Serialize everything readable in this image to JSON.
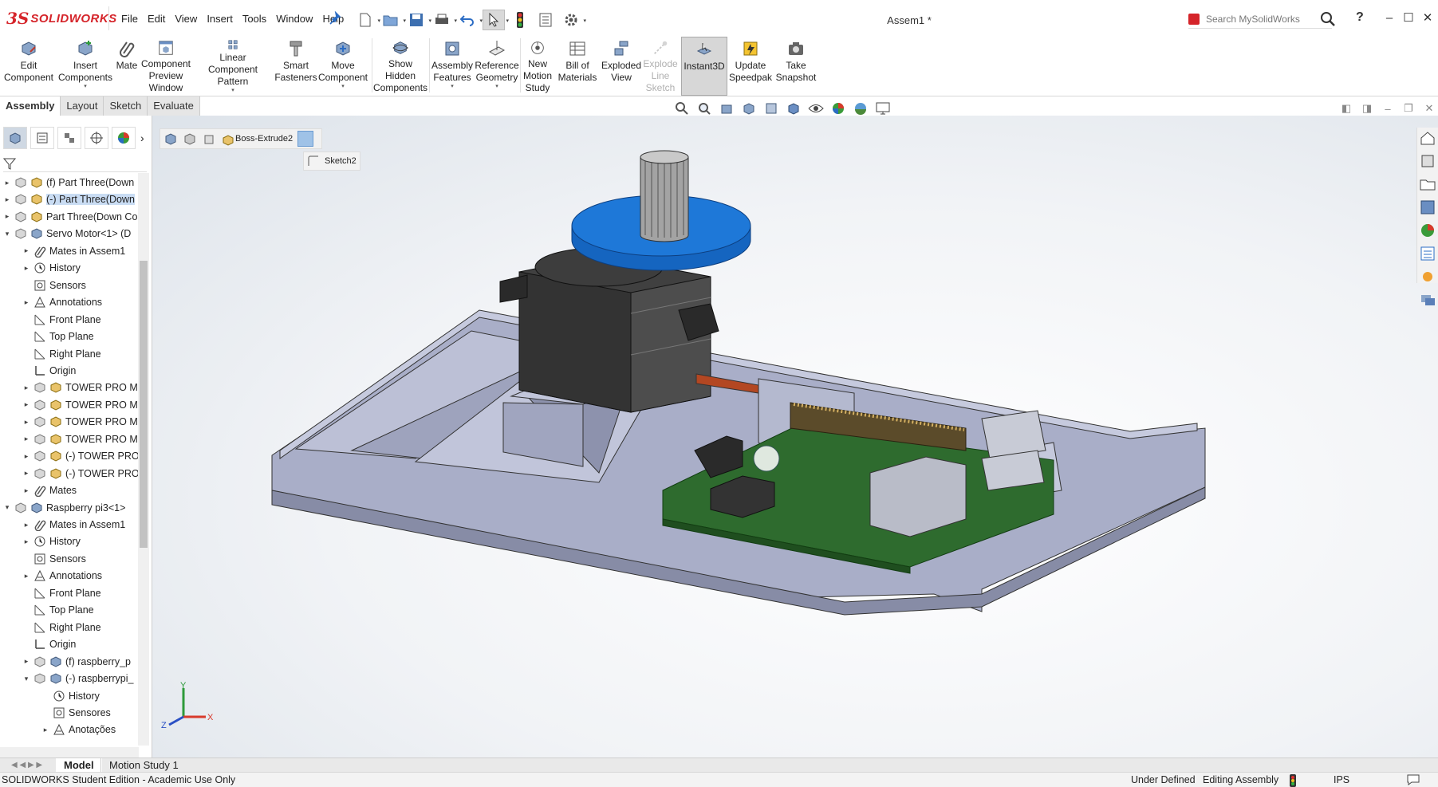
{
  "app": {
    "logo_prefix": "3S",
    "logo_text": "SOLIDWORKS",
    "document_title": "Assem1 *"
  },
  "menu": [
    "File",
    "Edit",
    "View",
    "Insert",
    "Tools",
    "Window",
    "Help"
  ],
  "search": {
    "placeholder": "Search MySolidWorks",
    "help": "?"
  },
  "commands": [
    {
      "label": "Edit\nComponent"
    },
    {
      "label": "Insert\nComponents"
    },
    {
      "label": "Mate"
    },
    {
      "label": "Component\nPreview\nWindow"
    },
    {
      "label": "Linear Component\nPattern"
    },
    {
      "label": "Smart\nFasteners"
    },
    {
      "label": "Move\nComponent"
    },
    {
      "label": "Show\nHidden\nComponents"
    },
    {
      "label": "Assembly\nFeatures"
    },
    {
      "label": "Reference\nGeometry"
    },
    {
      "label": "New\nMotion\nStudy"
    },
    {
      "label": "Bill of\nMaterials"
    },
    {
      "label": "Exploded\nView"
    },
    {
      "label": "Explode\nLine\nSketch"
    },
    {
      "label": "Instant3D"
    },
    {
      "label": "Update\nSpeedpak"
    },
    {
      "label": "Take\nSnapshot"
    }
  ],
  "cm_tabs": [
    "Assembly",
    "Layout",
    "Sketch",
    "Evaluate"
  ],
  "tree": [
    {
      "label": "(f) Part Three(Down"
    },
    {
      "label": "(-) Part Three(Down"
    },
    {
      "label": "Part Three(Down Co"
    },
    {
      "label": "Servo Motor<1> (D"
    },
    {
      "label": "Mates in Assem1"
    },
    {
      "label": "History"
    },
    {
      "label": "Sensors"
    },
    {
      "label": "Annotations"
    },
    {
      "label": "Front Plane"
    },
    {
      "label": "Top Plane"
    },
    {
      "label": "Right Plane"
    },
    {
      "label": "Origin"
    },
    {
      "label": "TOWER PRO M"
    },
    {
      "label": "TOWER PRO M"
    },
    {
      "label": "TOWER PRO M"
    },
    {
      "label": "TOWER PRO M"
    },
    {
      "label": "(-) TOWER PRO"
    },
    {
      "label": "(-) TOWER PRO"
    },
    {
      "label": "Mates"
    },
    {
      "label": "Raspberry pi3<1>"
    },
    {
      "label": "Mates in Assem1"
    },
    {
      "label": "History"
    },
    {
      "label": "Sensors"
    },
    {
      "label": "Annotations"
    },
    {
      "label": "Front Plane"
    },
    {
      "label": "Top Plane"
    },
    {
      "label": "Right Plane"
    },
    {
      "label": "Origin"
    },
    {
      "label": "(f) raspberry_p"
    },
    {
      "label": "(-) raspberrypi_"
    },
    {
      "label": "History"
    },
    {
      "label": "Sensores"
    },
    {
      "label": "Anotações"
    }
  ],
  "breadcrumb": {
    "feature": "Boss-Extrude2",
    "sketch": "Sketch2"
  },
  "triad": {
    "y": "Y",
    "x": "X",
    "z": "Z"
  },
  "bottom_tabs": [
    "Model",
    "Motion Study 1"
  ],
  "status": {
    "edition": "SOLIDWORKS Student Edition - Academic Use Only",
    "sketch_state": "Under Defined",
    "mode": "Editing Assembly",
    "units": "IPS"
  },
  "colors": {
    "accent": "#d5242a",
    "selection": "#1e78d8",
    "part_gray": "#b7bcd2",
    "board_green": "#2e6b2e"
  }
}
